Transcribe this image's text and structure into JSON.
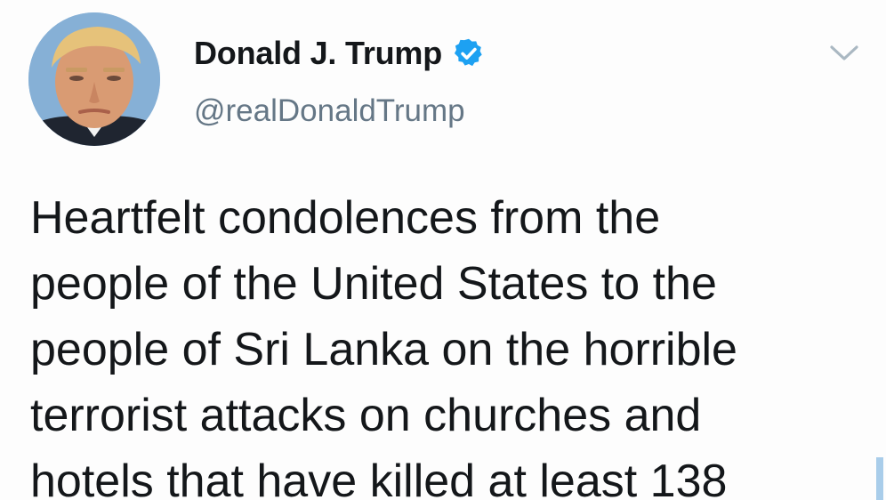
{
  "tweet": {
    "author": {
      "display_name": "Donald J. Trump",
      "handle": "@realDonaldTrump",
      "verified": true,
      "avatar_icon": "profile-avatar"
    },
    "menu_icon": "chevron-down-icon",
    "text": "Heartfelt condolences from the\npeople of the United States to the\npeople of Sri Lanka on the horrible\nterrorist attacks on churches and\nhotels that have killed at least 138",
    "colors": {
      "name": "#14171a",
      "handle": "#657786",
      "verified_badge": "#1da1f2",
      "chevron": "#aab8c2",
      "scroll_marker": "#a9cdea"
    }
  }
}
